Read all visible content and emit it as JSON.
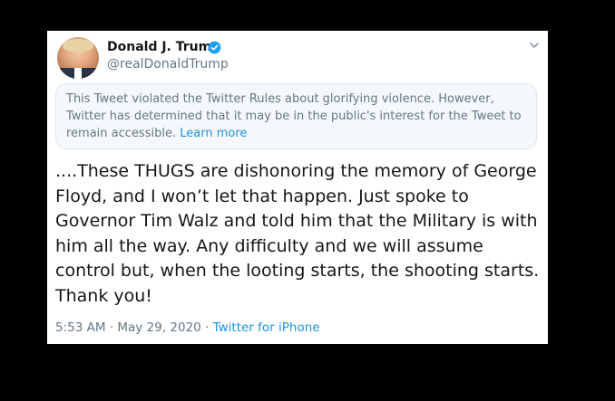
{
  "user": {
    "display_name": "Donald J. Trump",
    "handle": "@realDonaldTrump",
    "verified_icon": "verified-badge-icon",
    "avatar_icon": "profile-avatar"
  },
  "notice": {
    "text": "This Tweet violated the Twitter Rules about glorifying violence. However, Twitter has determined that it may be in the public's interest for the Tweet to remain accessible.",
    "link_label": "Learn more"
  },
  "tweet": {
    "text": "....These THUGS are dishonoring the memory of George Floyd, and I won’t let that happen. Just spoke to Governor Tim Walz and told him that the Military is with him all the way. Any difficulty and we will assume control but, when the looting starts, the shooting starts. Thank you!"
  },
  "meta": {
    "time": "5:53 AM",
    "separator": "·",
    "date": "May 29, 2020",
    "source": "Twitter for iPhone"
  },
  "menu": {
    "icon": "chevron-down-icon"
  },
  "colors": {
    "background": "#000000",
    "card": "#ffffff",
    "verified_blue": "#1da1f2",
    "link_blue": "#1b95e0",
    "muted_text": "#657786",
    "primary_text": "#14171a",
    "notice_bg": "#f5f8fa"
  }
}
